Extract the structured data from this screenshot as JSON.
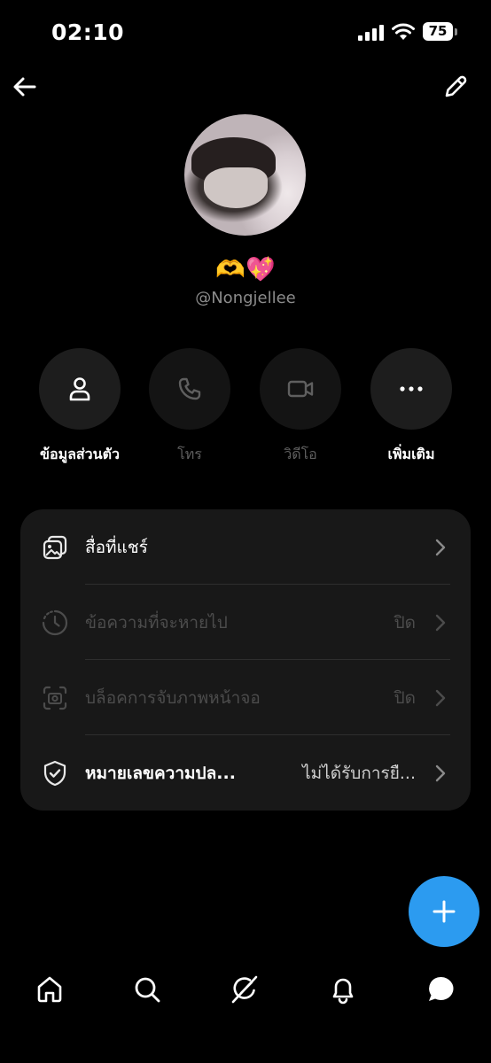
{
  "status_bar": {
    "time": "02:10",
    "battery": "75"
  },
  "profile": {
    "display_name": "🫶💖",
    "username": "@Nongjellee"
  },
  "actions": [
    {
      "label": "ข้อมูลส่วนตัว",
      "icon": "person-icon"
    },
    {
      "label": "โทร",
      "icon": "phone-icon"
    },
    {
      "label": "วิดีโอ",
      "icon": "video-icon"
    },
    {
      "label": "เพิ่มเติม",
      "icon": "more-icon"
    }
  ],
  "settings": [
    {
      "label": "สื่อที่แชร์",
      "value": "",
      "icon": "shared-media-icon"
    },
    {
      "label": "ข้อความที่จะหายไป",
      "value": "ปิด",
      "icon": "timer-icon"
    },
    {
      "label": "บล็อคการจับภาพหน้าจอ",
      "value": "ปิด",
      "icon": "screenshot-icon"
    },
    {
      "label": "หมายเลขความปล...",
      "value": "ไม่ได้รับการยื...",
      "icon": "shield-check-icon"
    }
  ],
  "colors": {
    "background": "#000000",
    "card": "#181818",
    "fab": "#2c9bf0",
    "muted": "#8b8b8b"
  },
  "tabs": [
    "home-icon",
    "search-icon",
    "grok-icon",
    "bell-icon",
    "messages-icon"
  ]
}
